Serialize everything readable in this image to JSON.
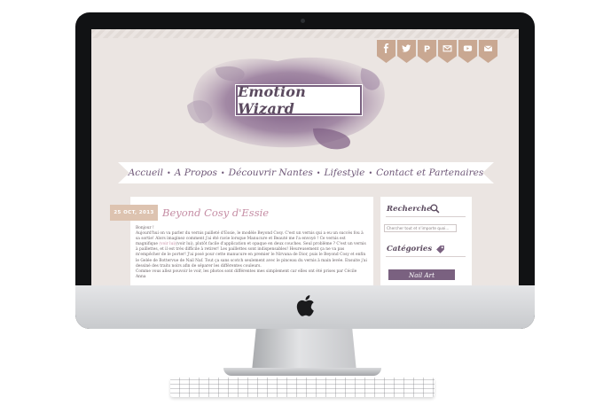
{
  "blog": {
    "title": "Emotion Wizard",
    "social_icons": [
      "facebook-icon",
      "twitter-icon",
      "pinterest-icon",
      "email-icon",
      "youtube-icon",
      "mail-icon"
    ],
    "social_glyphs": [
      "f",
      "t",
      "P",
      "@",
      "▶",
      "✉"
    ]
  },
  "nav": {
    "items": [
      "Accueil",
      "A Propos",
      "Découvrir Nantes",
      "Lifestyle",
      "Contact et Partenaires"
    ],
    "separator": "•"
  },
  "post": {
    "date": "25 OCT, 2013",
    "title": "Beyond Cosy d'Essie",
    "body": [
      "Bonjour !",
      "Aujourd'hui on va parler du vernis pailleté d'Essie, le modèle Beyond Cosy. C'est un vernis qui a eu un succès fou à sa sortie! Alors imaginez comment j'ai été ravie lorsque Manucure et Beauté me l'a envoyé ! Ce vernis est magnifique",
      "(voir lui), plutôt facile d'application et opaque en deux couches. Seul problème ? C'est un vernis à paillettes, et il est très difficile à retirer! Les paillettes sont indispensables! Heureusement ça ne va pas m'empêcher de le porter! J'ai posé pour cette manucure en premier le Nirvana de Dior, puis le Beyond Cosy et enfin le Gelée de Bottervue de Nail Naf. Tout ça sans scotch seulement avec le pinceau du vernis à main levée. Ensuite j'ai dessiné des traits noirs afin de séparer les différentes couleurs.",
      "Comme vous allez pouvoir le voir, les photos sont différentes mes simplement car elles ont été prises par Cécile Anna"
    ],
    "link_text": "(voir lui)"
  },
  "sidebar": {
    "search_heading": "Recherche",
    "search_placeholder": "Chercher tout et n'importe quoi...",
    "categories_heading": "Catégories",
    "category_button": "Nail Art"
  },
  "colors": {
    "screen_bg": "#ebe5e2",
    "accent_plum": "#7a6180",
    "accent_pink": "#c58da4",
    "flag_tan": "#c9a892",
    "date_badge": "#ddc3b0"
  }
}
